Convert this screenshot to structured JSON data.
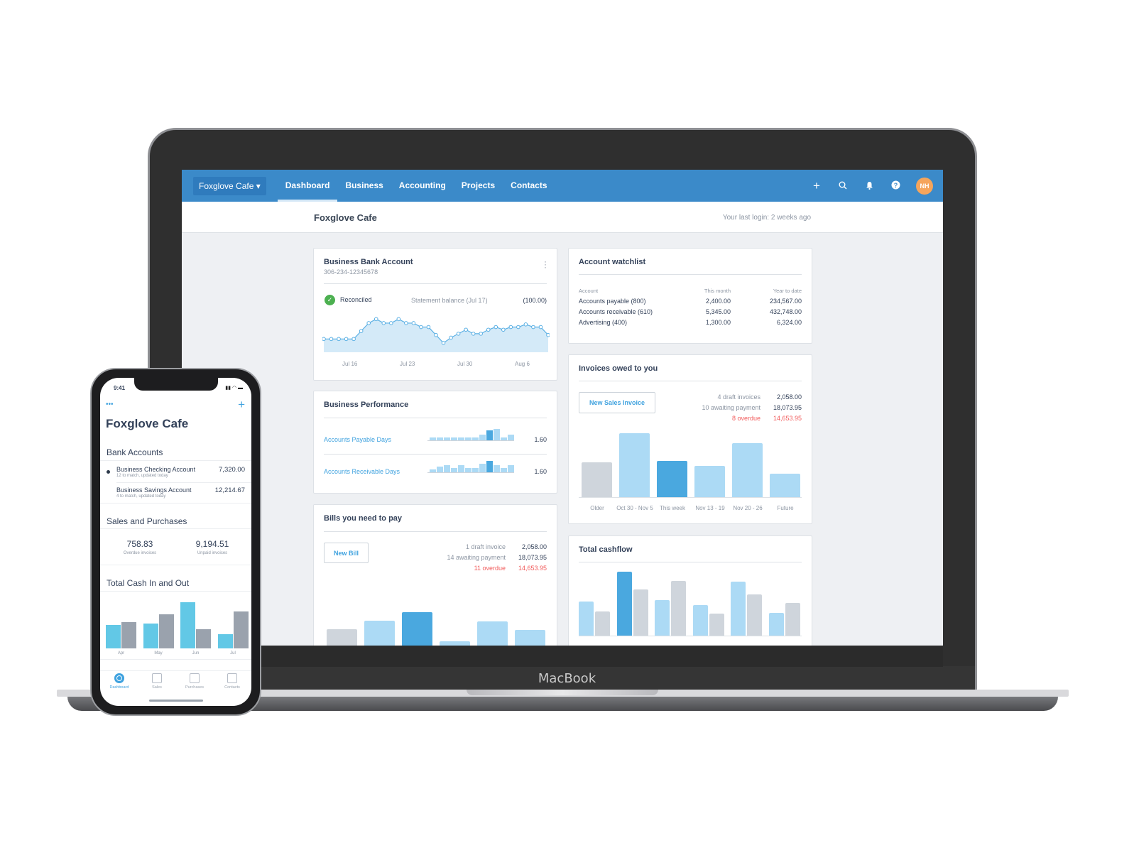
{
  "device_brand": "MacBook",
  "web": {
    "nav": {
      "org_switcher": "Foxglove Cafe",
      "items": [
        "Dashboard",
        "Business",
        "Accounting",
        "Projects",
        "Contacts"
      ],
      "active": "Dashboard",
      "icons": [
        "plus-icon",
        "search-icon",
        "bell-icon",
        "help-icon"
      ],
      "avatar_initials": "NH"
    },
    "subheader": {
      "title": "Foxglove Cafe",
      "last_login": "Your last login: 2 weeks ago"
    },
    "bank": {
      "title": "Business Bank Account",
      "account_number": "306-234-12345678",
      "status": "Reconciled",
      "statement_label": "Statement balance (Jul 17)",
      "statement_value": "(100.00)",
      "x_labels": [
        "Jul 16",
        "Jul 23",
        "Jul 30",
        "Aug 6"
      ],
      "series": [
        40,
        40,
        40,
        40,
        40,
        46,
        52,
        55,
        52,
        52,
        55,
        52,
        52,
        49,
        49,
        43,
        37,
        41,
        44,
        47,
        44,
        44,
        47,
        49,
        47,
        49,
        49,
        51,
        49,
        49,
        43
      ]
    },
    "performance": {
      "title": "Business Performance",
      "rows": [
        {
          "label": "Accounts Payable Days",
          "value": "1.60",
          "bars": [
            2,
            2,
            2,
            2,
            2,
            2,
            2,
            4,
            7,
            8,
            2,
            4
          ],
          "highlight": 8
        },
        {
          "label": "Accounts Receivable Days",
          "value": "1.60",
          "bars": [
            2,
            4,
            5,
            3,
            5,
            3,
            3,
            6,
            8,
            5,
            3,
            5
          ],
          "highlight": 8
        }
      ]
    },
    "bills": {
      "title": "Bills you need to pay",
      "button": "New Bill",
      "rows": [
        {
          "label": "1 draft invoice",
          "value": "2,058.00",
          "overdue": false
        },
        {
          "label": "14 awaiting payment",
          "value": "18,073.95",
          "overdue": false
        },
        {
          "label": "11 overdue",
          "value": "14,653.95",
          "overdue": true
        }
      ],
      "bars": [
        {
          "v": 45,
          "c": "grey"
        },
        {
          "v": 57,
          "c": "light"
        },
        {
          "v": 69,
          "c": "dark"
        },
        {
          "v": 28,
          "c": "light"
        },
        {
          "v": 56,
          "c": "light"
        },
        {
          "v": 44,
          "c": "light"
        }
      ]
    },
    "watchlist": {
      "title": "Account watchlist",
      "columns": [
        "Account",
        "This month",
        "Year to date"
      ],
      "rows": [
        [
          "Accounts payable (800)",
          "2,400.00",
          "234,567.00"
        ],
        [
          "Accounts receivable (610)",
          "5,345.00",
          "432,748.00"
        ],
        [
          "Advertising (400)",
          "1,300.00",
          "6,324.00"
        ]
      ]
    },
    "invoices": {
      "title": "Invoices owed to you",
      "button": "New Sales Invoice",
      "rows": [
        {
          "label": "4 draft invoices",
          "value": "2,058.00",
          "overdue": false
        },
        {
          "label": "10 awaiting payment",
          "value": "18,073.95",
          "overdue": false
        },
        {
          "label": "8 overdue",
          "value": "14,653.95",
          "overdue": true
        }
      ],
      "categories": [
        "Older",
        "Oct 30 - Nov 5",
        "This week",
        "Nov 13 - 19",
        "Nov 20 - 26",
        "Future"
      ],
      "bars": [
        {
          "v": 49,
          "c": "grey"
        },
        {
          "v": 90,
          "c": "light"
        },
        {
          "v": 51,
          "c": "dark"
        },
        {
          "v": 44,
          "c": "light"
        },
        {
          "v": 76,
          "c": "light"
        },
        {
          "v": 33,
          "c": "light"
        }
      ]
    },
    "cashflow": {
      "title": "Total cashflow",
      "pairs": [
        [
          48,
          34
        ],
        [
          90,
          65
        ],
        [
          50,
          77
        ],
        [
          43,
          31
        ],
        [
          76,
          58
        ],
        [
          32,
          46
        ]
      ],
      "highlight": 1
    }
  },
  "phone": {
    "time": "9:41",
    "title": "Foxglove Cafe",
    "bank_section": "Bank Accounts",
    "accounts": [
      {
        "name": "Business Checking Account",
        "sub": "12 to match, updated today",
        "value": "7,320.00"
      },
      {
        "name": "Business Savings Account",
        "sub": "4 to match, updated today",
        "value": "12,214.67"
      }
    ],
    "sales_section": "Sales and Purchases",
    "stats": [
      {
        "value": "758.83",
        "label": "Overdue invoices"
      },
      {
        "value": "9,194.51",
        "label": "Unpaid invoices"
      }
    ],
    "cash_section": "Total Cash In and Out",
    "cash": {
      "categories": [
        "Apr",
        "May",
        "Jun",
        "Jul"
      ],
      "cash_in": [
        33,
        35,
        65,
        20
      ],
      "cash_out": [
        37,
        48,
        27,
        52
      ]
    },
    "tabs": [
      "Dashboard",
      "Sales",
      "Purchases",
      "Contacts"
    ],
    "active_tab": "Dashboard"
  }
}
